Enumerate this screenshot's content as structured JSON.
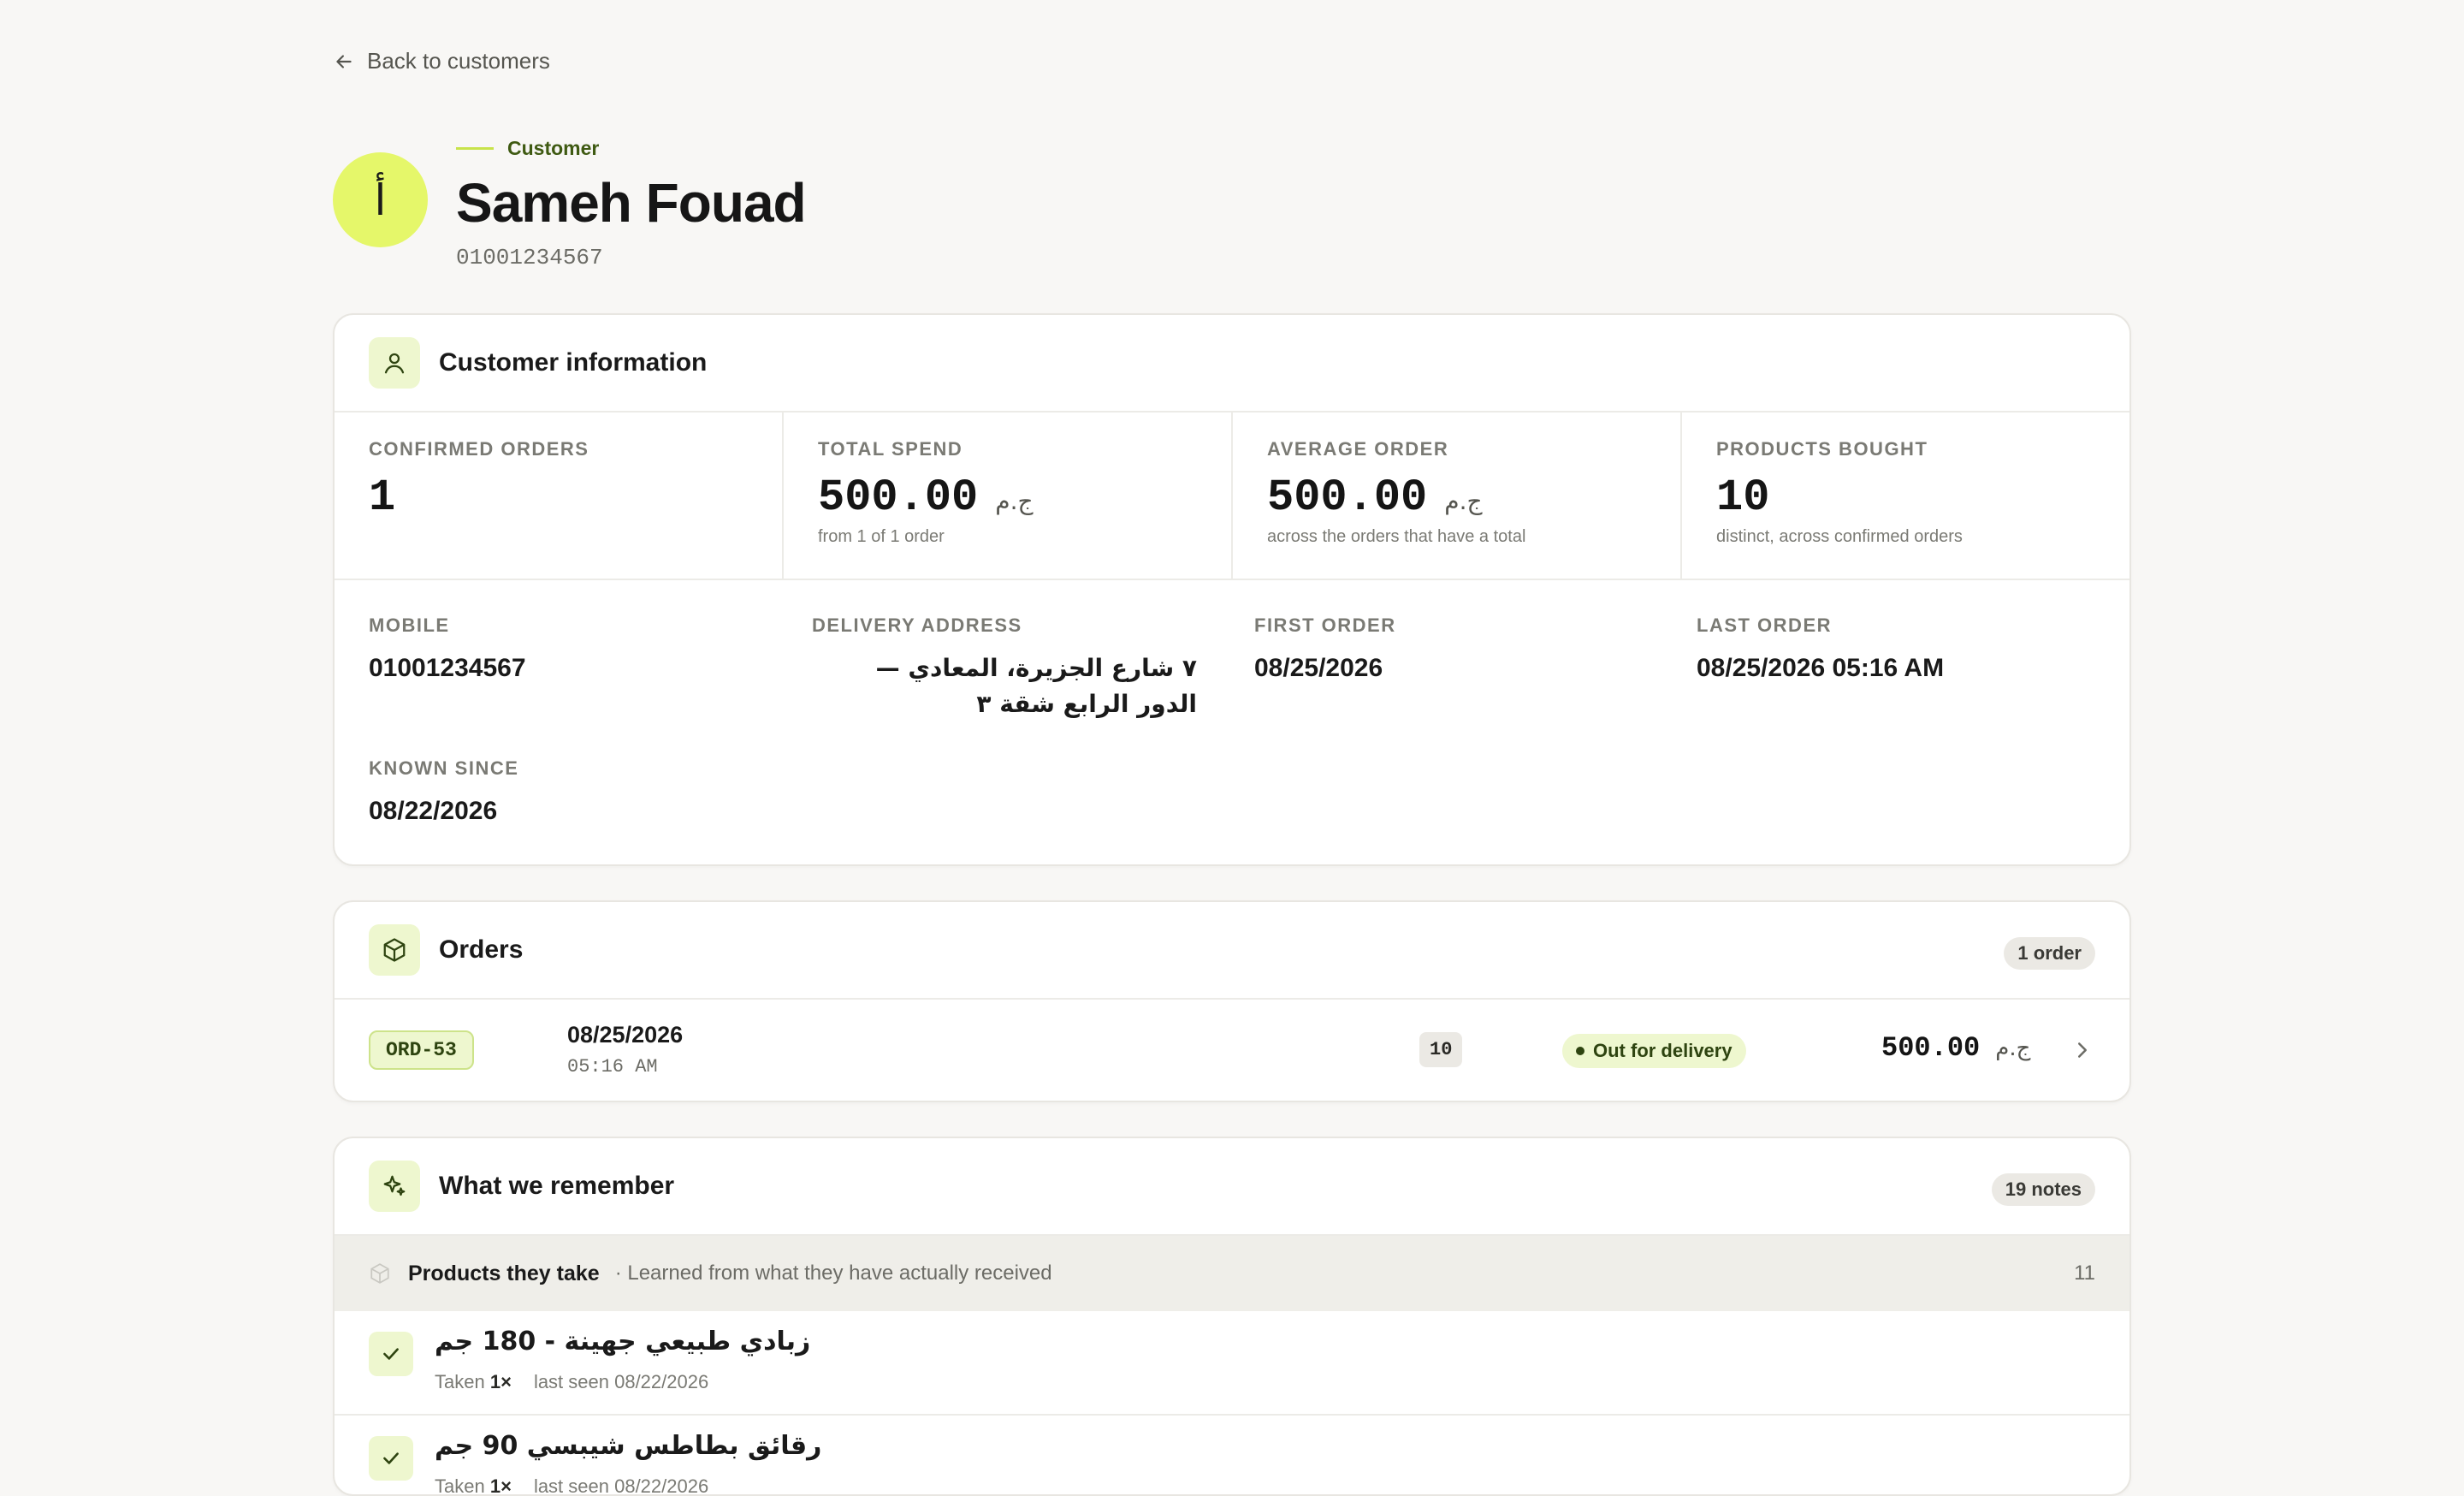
{
  "nav": {
    "back_label": "Back to customers"
  },
  "customer": {
    "avatar_letter": "أ",
    "eyebrow": "Customer",
    "name": "Sameh Fouad",
    "phone": "01001234567"
  },
  "info_card": {
    "title": "Customer information",
    "stats": [
      {
        "label": "CONFIRMED ORDERS",
        "value": "1",
        "currency": "",
        "sub": ""
      },
      {
        "label": "TOTAL SPEND",
        "value": "500.00",
        "currency": "ج.م",
        "sub": "from 1 of 1 order"
      },
      {
        "label": "AVERAGE ORDER",
        "value": "500.00",
        "currency": "ج.م",
        "sub": "across the orders that have a total"
      },
      {
        "label": "PRODUCTS BOUGHT",
        "value": "10",
        "currency": "",
        "sub": "distinct, across confirmed orders"
      }
    ],
    "fields": {
      "mobile": {
        "label": "MOBILE",
        "value": "01001234567"
      },
      "address": {
        "label": "DELIVERY ADDRESS",
        "value": "٧ شارع الجزيرة، المعادي — الدور الرابع شقة ٣"
      },
      "first_order": {
        "label": "FIRST ORDER",
        "value": "08/25/2026"
      },
      "last_order": {
        "label": "LAST ORDER",
        "value": "08/25/2026 05:16 AM"
      },
      "known_since": {
        "label": "KNOWN SINCE",
        "value": "08/22/2026"
      }
    }
  },
  "orders_card": {
    "title": "Orders",
    "count_badge": "1 order",
    "rows": [
      {
        "id": "ORD-53",
        "date": "08/25/2026",
        "time": "05:16 AM",
        "items": "10",
        "status": "Out for delivery",
        "total": "500.00",
        "currency": "ج.م"
      }
    ]
  },
  "memory_card": {
    "title": "What we remember",
    "count_badge": "19 notes",
    "section": {
      "title": "Products they take",
      "subtitle": "· Learned from what they have actually received",
      "count": "11"
    },
    "items": [
      {
        "name": "زبادي طبيعي جهينة - 180 جم",
        "taken_prefix": "Taken",
        "taken_count": "1×",
        "last_seen": "last seen 08/22/2026"
      },
      {
        "name": "رقائق بطاطس شيبسي 90 جم",
        "taken_prefix": "Taken",
        "taken_count": "1×",
        "last_seen": "last seen 08/22/2026"
      }
    ]
  },
  "colors": {
    "accent": "#e5f76a",
    "accent_soft": "#eef7cf",
    "accent_dark": "#2e4410",
    "background": "#f8f7f5"
  }
}
